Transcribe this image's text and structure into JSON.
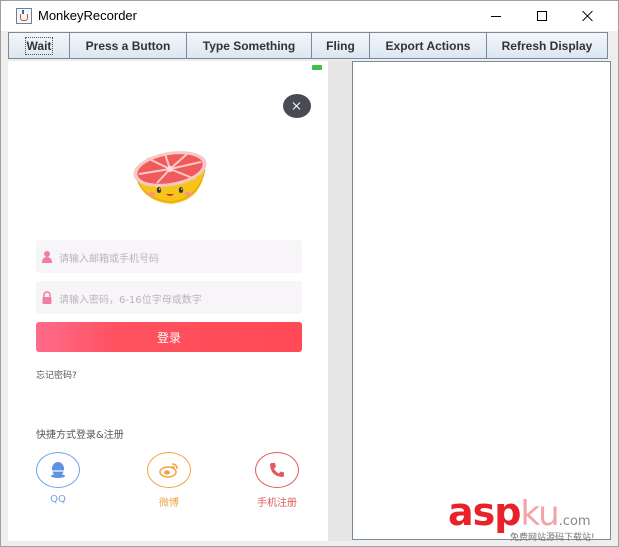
{
  "window": {
    "title": "MonkeyRecorder"
  },
  "toolbar": {
    "buttons": [
      {
        "label": "Wait"
      },
      {
        "label": "Press a Button"
      },
      {
        "label": "Type Something"
      },
      {
        "label": "Fling"
      },
      {
        "label": "Export Actions"
      },
      {
        "label": "Refresh Display"
      }
    ]
  },
  "phone": {
    "username_placeholder": "请输入邮箱或手机号码",
    "password_placeholder": "请输入密码，6-16位字母或数字",
    "login_label": "登录",
    "forgot_label": "忘记密码?",
    "quick_login_label": "快捷方式登录&注册",
    "social": [
      {
        "label": "QQ",
        "icon": "qq-icon",
        "color": "#6fa2e8"
      },
      {
        "label": "微博",
        "icon": "weibo-icon",
        "color": "#f0a540"
      },
      {
        "label": "手机注册",
        "icon": "phone-icon",
        "color": "#e35a5a"
      }
    ],
    "accent_color": "#ff4a55"
  },
  "watermark": {
    "brand_asp": "asp",
    "brand_ku": "ku",
    "brand_com": ".com",
    "subtitle": "免费网站源码下载站!"
  }
}
